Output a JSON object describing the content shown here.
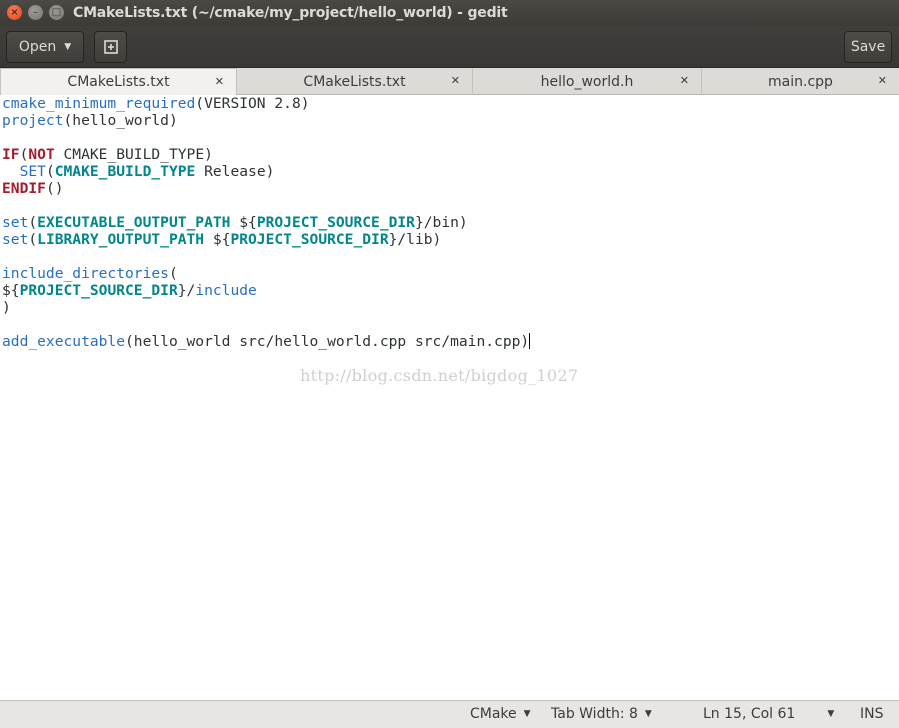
{
  "window": {
    "title": "CMakeLists.txt (~/cmake/my_project/hello_world) - gedit",
    "close_glyph": "×",
    "minimize_glyph": "–",
    "maximize_glyph": "□"
  },
  "toolbar": {
    "open_label": "Open",
    "save_label": "Save"
  },
  "tabs": [
    {
      "label": "CMakeLists.txt",
      "active": true
    },
    {
      "label": "CMakeLists.txt",
      "active": false
    },
    {
      "label": "hello_world.h",
      "active": false
    },
    {
      "label": "main.cpp",
      "active": false
    }
  ],
  "editor": {
    "lines": [
      [
        {
          "t": "cmake_minimum_required",
          "c": "cmd"
        },
        {
          "t": "(VERSION 2.8)",
          "c": "plain"
        }
      ],
      [
        {
          "t": "project",
          "c": "cmd"
        },
        {
          "t": "(hello_world)",
          "c": "plain"
        }
      ],
      [],
      [
        {
          "t": "IF",
          "c": "kw"
        },
        {
          "t": "(",
          "c": "plain"
        },
        {
          "t": "NOT",
          "c": "kw"
        },
        {
          "t": " CMAKE_BUILD_TYPE)",
          "c": "plain"
        }
      ],
      [
        {
          "t": "  ",
          "c": "plain"
        },
        {
          "t": "SET",
          "c": "cmd"
        },
        {
          "t": "(",
          "c": "plain"
        },
        {
          "t": "CMAKE_BUILD_TYPE",
          "c": "var"
        },
        {
          "t": " Release)",
          "c": "plain"
        }
      ],
      [
        {
          "t": "ENDIF",
          "c": "kw"
        },
        {
          "t": "()",
          "c": "plain"
        }
      ],
      [],
      [
        {
          "t": "set",
          "c": "cmd"
        },
        {
          "t": "(",
          "c": "plain"
        },
        {
          "t": "EXECUTABLE_OUTPUT_PATH",
          "c": "var"
        },
        {
          "t": " ${",
          "c": "plain"
        },
        {
          "t": "PROJECT_SOURCE_DIR",
          "c": "var"
        },
        {
          "t": "}/bin)",
          "c": "plain"
        }
      ],
      [
        {
          "t": "set",
          "c": "cmd"
        },
        {
          "t": "(",
          "c": "plain"
        },
        {
          "t": "LIBRARY_OUTPUT_PATH",
          "c": "var"
        },
        {
          "t": " ${",
          "c": "plain"
        },
        {
          "t": "PROJECT_SOURCE_DIR",
          "c": "var"
        },
        {
          "t": "}/lib)",
          "c": "plain"
        }
      ],
      [],
      [
        {
          "t": "include_directories",
          "c": "cmd"
        },
        {
          "t": "(",
          "c": "plain"
        }
      ],
      [
        {
          "t": "${",
          "c": "plain"
        },
        {
          "t": "PROJECT_SOURCE_DIR",
          "c": "var"
        },
        {
          "t": "}/",
          "c": "plain"
        },
        {
          "t": "include",
          "c": "cmd"
        }
      ],
      [
        {
          "t": ")",
          "c": "plain"
        }
      ],
      [],
      [
        {
          "t": "add_executable",
          "c": "cmd"
        },
        {
          "t": "(hello_world src/hello_world.cpp src/main.cpp)",
          "c": "plain"
        },
        {
          "t": "",
          "c": "caret"
        }
      ]
    ],
    "watermark": "http://blog.csdn.net/bigdog_1027"
  },
  "statusbar": {
    "language": "CMake",
    "tab_width": "Tab Width: 8",
    "position": "Ln 15, Col 61",
    "mode": "INS"
  },
  "colors": {
    "command": "#2a6fbe",
    "keyword": "#a51d2d",
    "variable": "#00868b",
    "titlebar": "#3c3b37",
    "close_button": "#e0491c"
  },
  "icons": {
    "new_tab": "new-document-icon",
    "dropdown": "triangle-down-icon"
  }
}
